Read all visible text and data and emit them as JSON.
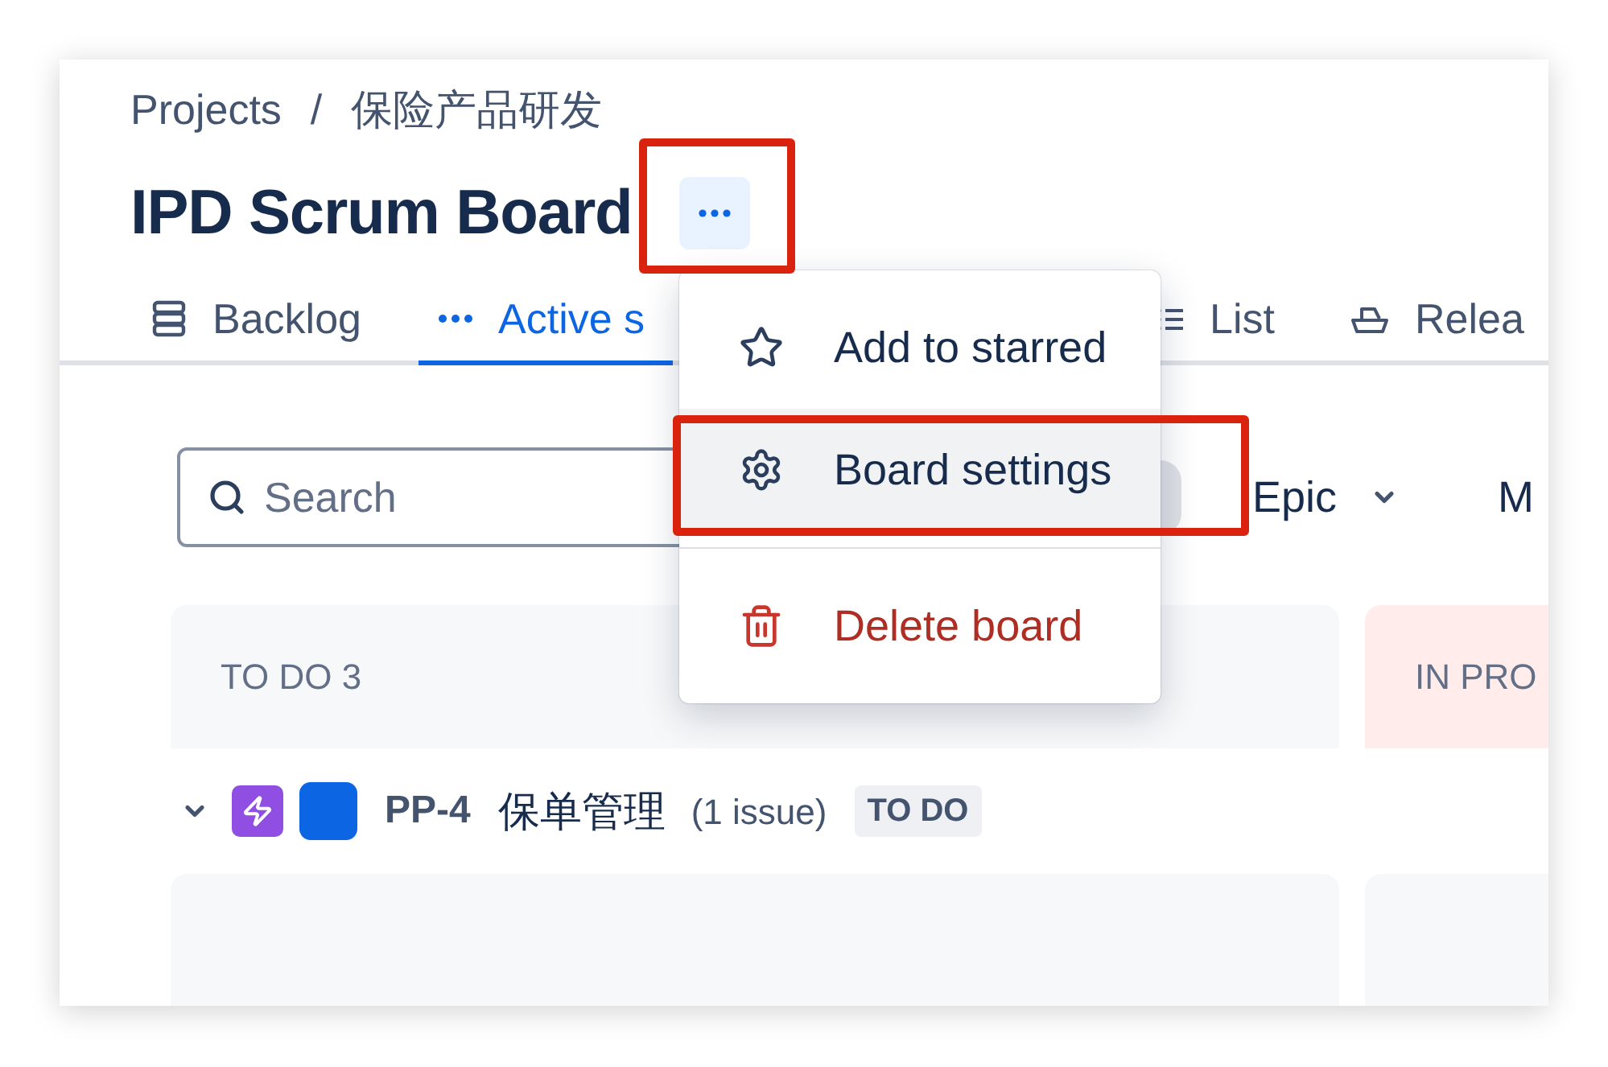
{
  "breadcrumb": {
    "items": [
      "Projects",
      "保险产品研发"
    ],
    "separator": "/"
  },
  "title": "IPD Scrum Board",
  "more_button": {
    "annotated": true
  },
  "tabs": [
    {
      "label": "Backlog",
      "selected": false
    },
    {
      "label": "Active s",
      "selected": true
    },
    {
      "label": "List",
      "selected": false
    },
    {
      "label": "Relea",
      "selected": false
    }
  ],
  "search": {
    "placeholder": "Search"
  },
  "filters": [
    {
      "label": "Epic",
      "dropdown": true
    },
    {
      "label": "M",
      "dropdown": false
    }
  ],
  "columns": [
    {
      "title": "TO DO 3",
      "kind": "todo"
    },
    {
      "title": "IN PRO",
      "kind": "in_progress"
    }
  ],
  "epic_row": {
    "expanded": true,
    "key": "PP-4",
    "name": "保单管理",
    "count": "(1 issue)",
    "status": "TO DO"
  },
  "menu": {
    "items": [
      {
        "label": "Add to starred",
        "kind": "action",
        "highlighted": false,
        "annotated": false
      },
      {
        "label": "Board settings",
        "kind": "action",
        "highlighted": true,
        "annotated": true
      },
      {
        "label": "Delete board",
        "kind": "danger",
        "highlighted": false,
        "annotated": false
      }
    ]
  }
}
